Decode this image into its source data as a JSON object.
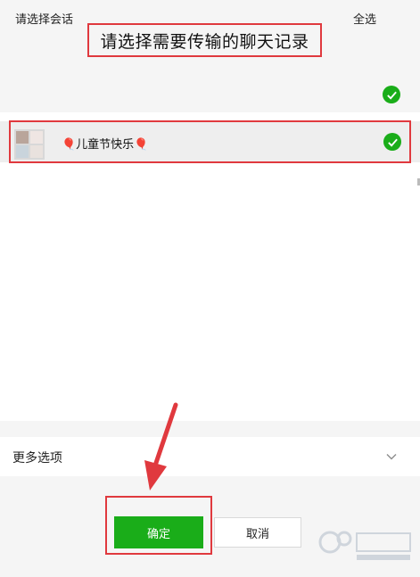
{
  "dialog": {
    "title": "请选择需要传输的聊天记录"
  },
  "header": {
    "label": "请选择会话",
    "select_all_label": "全选"
  },
  "chats": [
    {
      "name": "🎈儿童节快乐🎈",
      "selected": true
    }
  ],
  "options": {
    "more_label": "更多选项"
  },
  "buttons": {
    "confirm_label": "确定",
    "cancel_label": "取消"
  },
  "colors": {
    "accent": "#1aad19",
    "highlight": "#e0393e"
  }
}
